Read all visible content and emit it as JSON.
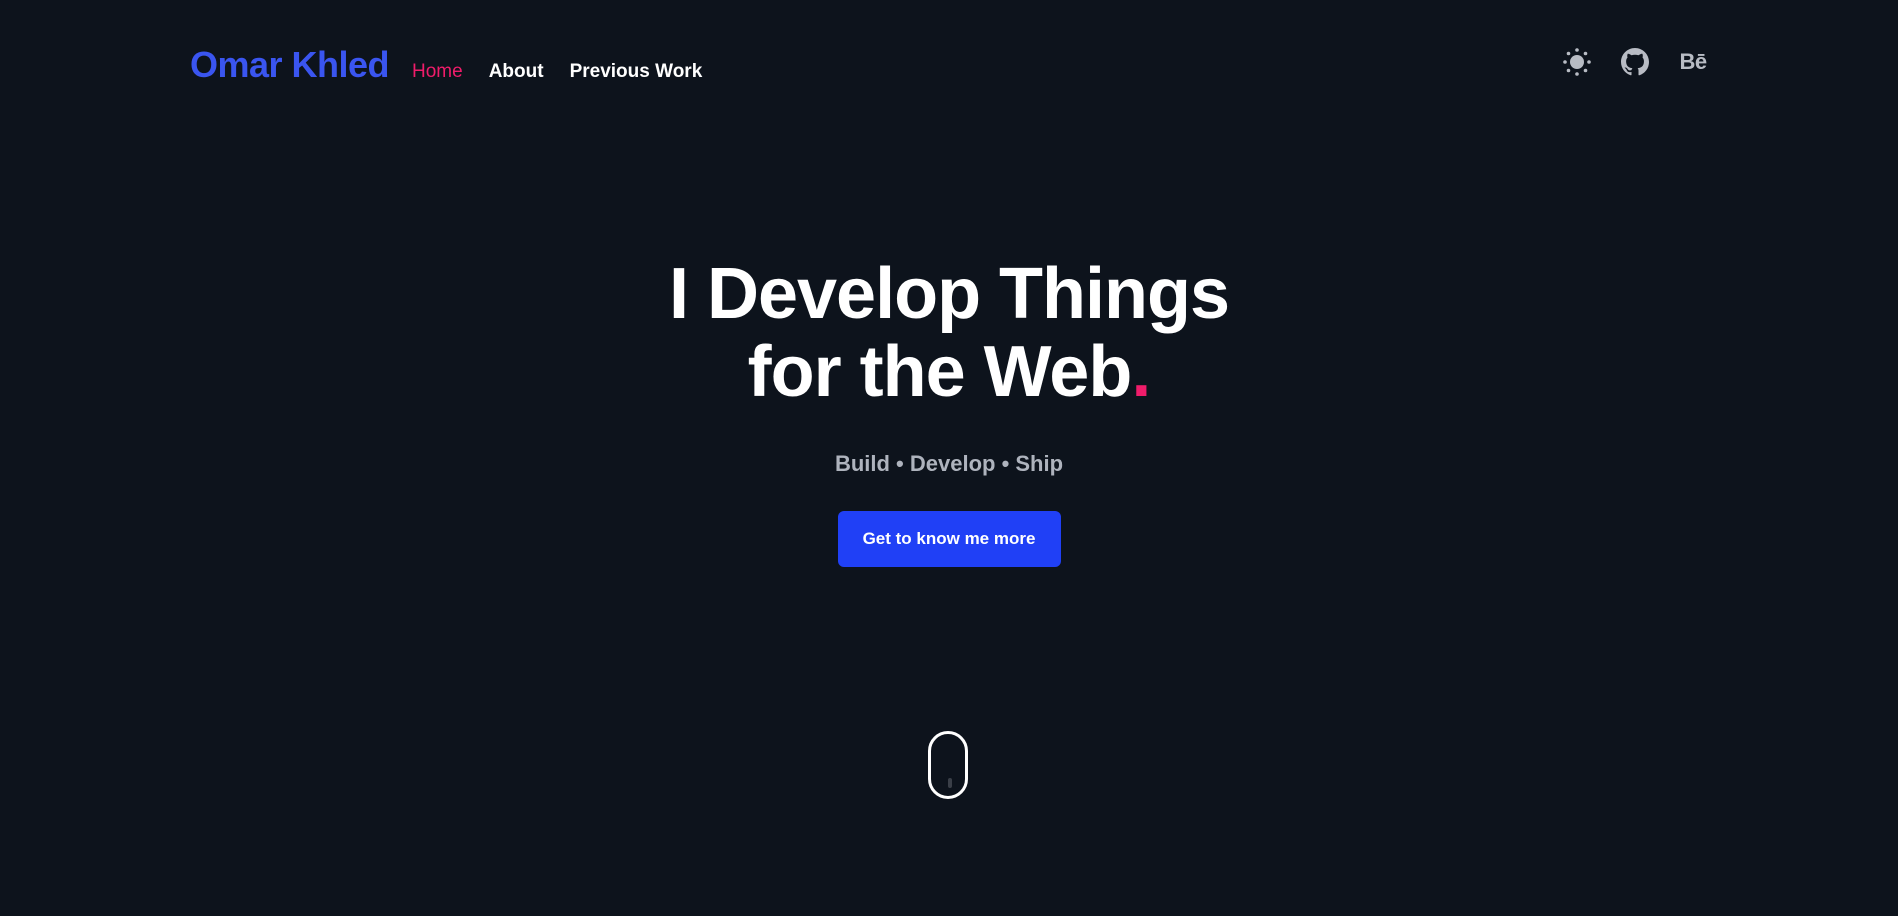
{
  "brand": {
    "name": "Omar Khled"
  },
  "nav": {
    "items": [
      {
        "label": "Home",
        "active": true
      },
      {
        "label": "About",
        "active": false
      },
      {
        "label": "Previous Work",
        "active": false
      }
    ]
  },
  "header_icons": {
    "theme_toggle": "sun-icon",
    "github": "github-icon",
    "behance_label": "Bē"
  },
  "hero": {
    "headline_line1": "I Develop Things",
    "headline_line2": "for the Web",
    "headline_dot": ".",
    "tagline": "Build • Develop • Ship",
    "cta_label": "Get to know me more"
  },
  "scroll_indicator": {
    "icon": "mouse-scroll-icon"
  },
  "colors": {
    "background": "#0d131c",
    "brand": "#3a55f0",
    "accent": "#ef1c6a",
    "button": "#2040f6",
    "text": "#ffffff",
    "muted": "#aeb3bd"
  }
}
